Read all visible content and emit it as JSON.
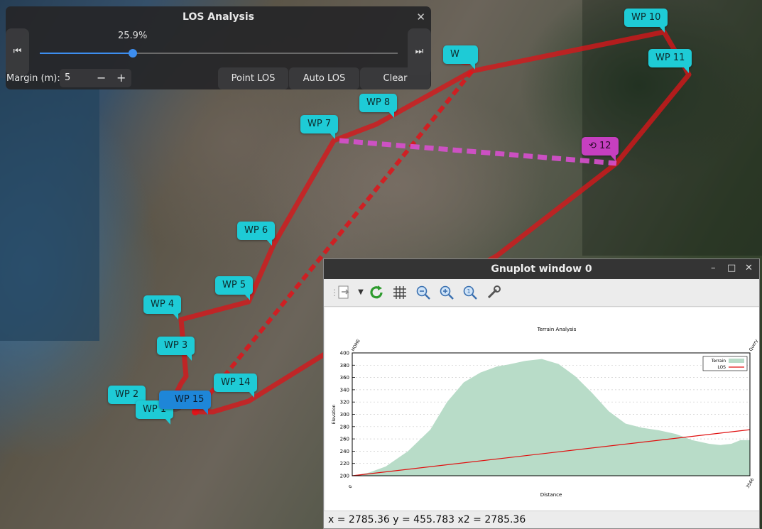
{
  "waypoints": {
    "wp10": "WP 10",
    "wp11": "WP 11",
    "wp_top": "W",
    "wp8": "WP 8",
    "wp7": "WP 7",
    "wp12": "⟲ 12",
    "wp6": "WP 6",
    "wp5": "WP 5",
    "wp4": "WP 4",
    "wp3": "WP 3",
    "wp2": "WP 2",
    "wp1": "WP 1",
    "wp15": "WP 15",
    "wp14": "WP 14"
  },
  "los_panel": {
    "title": "LOS Analysis",
    "close_icon": "close-icon",
    "progress_label": "25.9%",
    "progress_value": 0.259,
    "skip_back_icon": "skip-back-icon",
    "skip_forward_icon": "skip-forward-icon",
    "margin_label": "Margin (m):",
    "margin_value": "5",
    "minus": "−",
    "plus": "+",
    "buttons": [
      "Point LOS",
      "Auto LOS",
      "Clear"
    ]
  },
  "gnuplot": {
    "window_title": "Gnuplot window 0",
    "window_controls": [
      "–",
      "□",
      "✕"
    ],
    "toolbar_icons": [
      "export-icon",
      "replot-icon",
      "grid-icon",
      "zoom-out-icon",
      "zoom-in-icon",
      "zoom-fit-icon",
      "settings-icon"
    ],
    "status": "x = 2785.36 y = 455.783 x2 = 2785.36"
  },
  "chart_data": {
    "type": "area",
    "title": "Terrain Analysis",
    "xlabel": "Distance",
    "ylabel": "Elevation",
    "x_ticks": [
      "0",
      "3566"
    ],
    "x2_ticks": [
      "HOME",
      "Query"
    ],
    "xlim": [
      0,
      3566
    ],
    "ylim": [
      200,
      400
    ],
    "y_ticks": [
      200,
      220,
      240,
      260,
      280,
      300,
      320,
      340,
      360,
      380,
      400
    ],
    "grid": "horizontal dotted",
    "legend_placement": "top-right",
    "series": [
      {
        "name": "Terrain",
        "color": "#b8dcc8",
        "x": [
          0,
          150,
          300,
          500,
          700,
          850,
          1000,
          1150,
          1300,
          1400,
          1550,
          1700,
          1850,
          2000,
          2150,
          2300,
          2450,
          2600,
          2750,
          2900,
          3050,
          3200,
          3300,
          3400,
          3480,
          3566
        ],
        "y": [
          200,
          205,
          215,
          240,
          275,
          320,
          352,
          368,
          378,
          381,
          387,
          390,
          382,
          362,
          335,
          305,
          285,
          278,
          274,
          268,
          258,
          252,
          250,
          252,
          258,
          258
        ]
      },
      {
        "name": "LOS",
        "color": "#e01010",
        "x": [
          0,
          3566
        ],
        "y": [
          200,
          275
        ]
      }
    ]
  }
}
